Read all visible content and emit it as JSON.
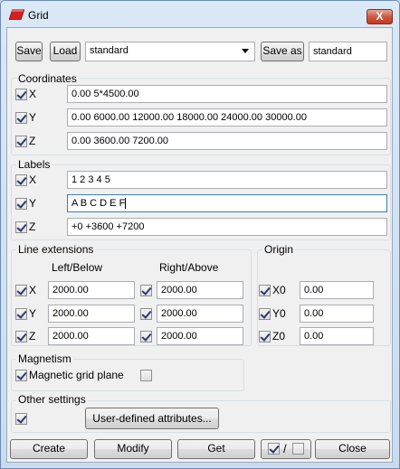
{
  "window": {
    "title": "Grid",
    "close_glyph": "X"
  },
  "top": {
    "save_label": "Save",
    "load_label": "Load",
    "preset_value": "standard",
    "save_as_label": "Save as",
    "save_as_value": "standard"
  },
  "coordinates": {
    "title": "Coordinates",
    "x_label": "X",
    "x_value": "0.00 5*4500.00",
    "y_label": "Y",
    "y_value": "0.00 6000.00 12000.00 18000.00 24000.00 30000.00",
    "z_label": "Z",
    "z_value": "0.00 3600.00 7200.00"
  },
  "labels": {
    "title": "Labels",
    "x_label": "X",
    "x_value": "1 2 3 4 5",
    "y_label": "Y",
    "y_value": "A B C D E F",
    "z_label": "Z",
    "z_value": "+0 +3600 +7200"
  },
  "line_extensions": {
    "title": "Line extensions",
    "left_header": "Left/Below",
    "right_header": "Right/Above",
    "x_label": "X",
    "x_left": "2000.00",
    "x_right": "2000.00",
    "y_label": "Y",
    "y_left": "2000.00",
    "y_right": "2000.00",
    "z_label": "Z",
    "z_left": "2000.00",
    "z_right": "2000.00"
  },
  "origin": {
    "title": "Origin",
    "x0_label": "X0",
    "x0_value": "0.00",
    "y0_label": "Y0",
    "y0_value": "0.00",
    "z0_label": "Z0",
    "z0_value": "0.00"
  },
  "magnetism": {
    "title": "Magnetism",
    "plane_label": "Magnetic grid plane"
  },
  "other": {
    "title": "Other settings",
    "udf_label": "User-defined attributes..."
  },
  "bottom": {
    "create_label": "Create",
    "modify_label": "Modify",
    "get_label": "Get",
    "toggle_sep": "/",
    "close_label": "Close"
  },
  "colors": {
    "title_close_red": "#c0391f",
    "window_frame": "#c6d8ec",
    "dialog_bg": "#f0f0f0"
  },
  "icons": {
    "app_icon": "tekla-red-slab-icon"
  }
}
